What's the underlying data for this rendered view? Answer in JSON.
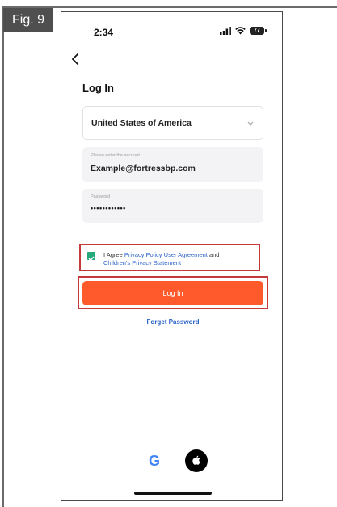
{
  "figure": {
    "label": "Fig. 9"
  },
  "status_bar": {
    "time": "2:34",
    "battery": "77"
  },
  "page": {
    "title": "Log In"
  },
  "region": {
    "value": "United States of America"
  },
  "account": {
    "placeholder": "Please enter the account",
    "value": "Example@fortressbp.com"
  },
  "password": {
    "placeholder": "Password",
    "masked_value": "••••••••••••"
  },
  "agreement": {
    "checked": true,
    "prefix": "I Agree",
    "privacy_policy": "Privacy Policy",
    "user_agreement": "User Agreement",
    "and": "and",
    "childrens_statement": "Children's Privacy Statement"
  },
  "login_button": {
    "label": "Log In"
  },
  "forgot_password": {
    "label": "Forget Password"
  },
  "social": {
    "google_letter": "G"
  },
  "colors": {
    "accent": "#ff5a2b",
    "link": "#2a62c9",
    "highlight": "#c43a3a",
    "check": "#25a87a"
  }
}
